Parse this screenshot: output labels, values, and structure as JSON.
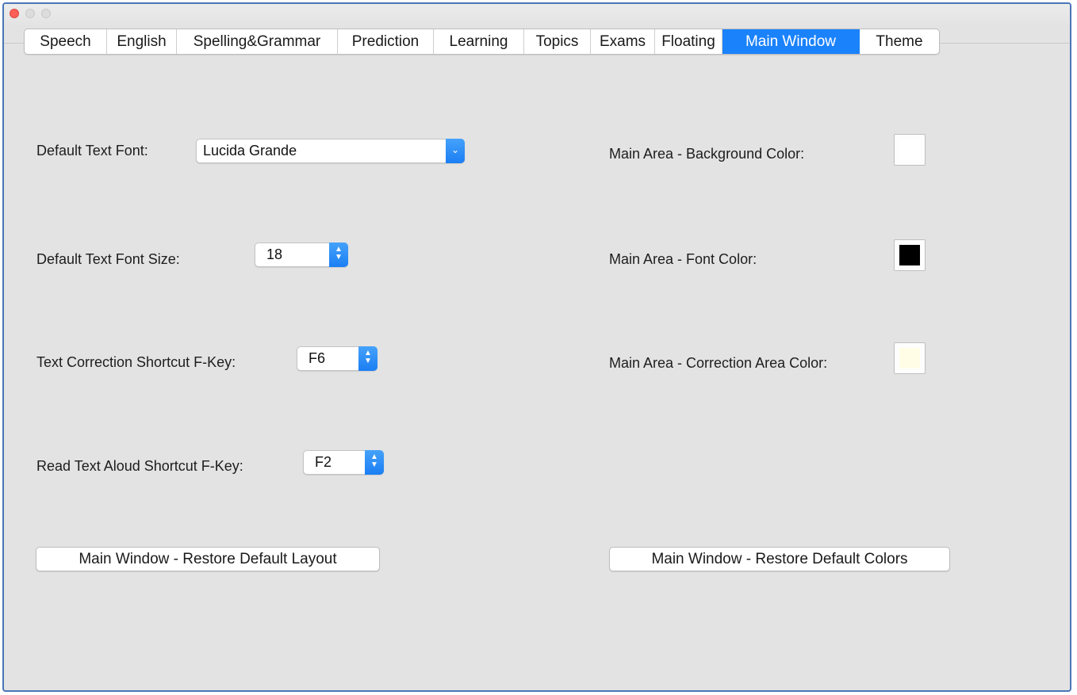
{
  "tabs": [
    {
      "label": "Speech"
    },
    {
      "label": "English"
    },
    {
      "label": "Spelling&Grammar"
    },
    {
      "label": "Prediction"
    },
    {
      "label": "Learning"
    },
    {
      "label": "Topics"
    },
    {
      "label": "Exams"
    },
    {
      "label": "Floating"
    },
    {
      "label": "Main Window",
      "active": true
    },
    {
      "label": "Theme"
    }
  ],
  "left": {
    "font_label": "Default Text Font:",
    "font_value": "Lucida Grande",
    "size_label": "Default Text Font Size:",
    "size_value": "18",
    "correction_label": "Text Correction Shortcut F-Key:",
    "correction_value": "F6",
    "read_label": "Read Text Aloud Shortcut F-Key:",
    "read_value": "F2",
    "restore_layout_button": "Main Window - Restore Default Layout"
  },
  "right": {
    "bg_label": "Main Area - Background Color:",
    "bg_color": "#ffffff",
    "font_label": "Main Area - Font Color:",
    "font_color": "#000000",
    "correction_label": "Main Area - Correction Area Color:",
    "correction_color": "#fffde6",
    "restore_colors_button": "Main Window - Restore Default Colors"
  },
  "colors": {
    "accent": "#1a82fb",
    "window_bg": "#e3e3e3",
    "close_light": "#fc5f57"
  }
}
